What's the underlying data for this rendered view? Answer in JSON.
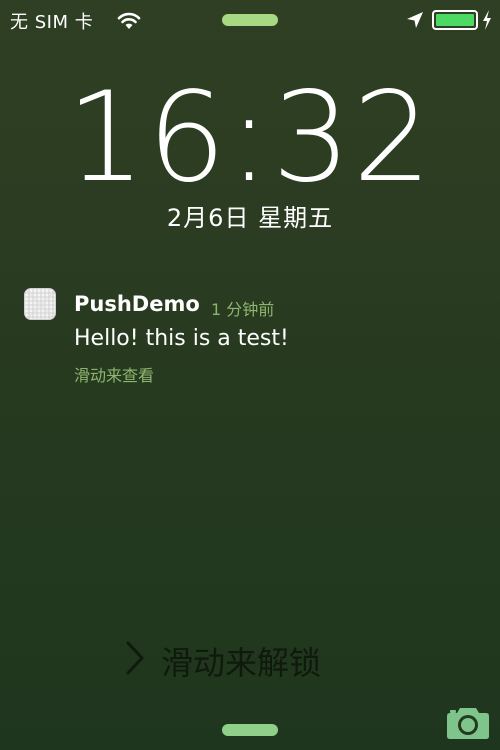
{
  "status_bar": {
    "carrier": "无 SIM 卡",
    "icons": [
      "wifi-icon",
      "location-arrow-icon",
      "battery-icon",
      "charging-bolt-icon"
    ],
    "battery_level": 1.0
  },
  "lock_screen": {
    "time": "16:32",
    "date": "2月6日 星期五",
    "unlock_label": "滑动来解锁",
    "icons": [
      "chevron-right-icon",
      "camera-icon"
    ]
  },
  "notification": {
    "app_name": "PushDemo",
    "time_ago": "1 分钟前",
    "message": "Hello! this is a test!",
    "action": "滑动来查看",
    "icon": "app-icon"
  },
  "colors": {
    "background": "#2b3c22",
    "accent_green": "#8fb46f",
    "battery_green": "#4cd964",
    "grabber": "#a8d884"
  }
}
